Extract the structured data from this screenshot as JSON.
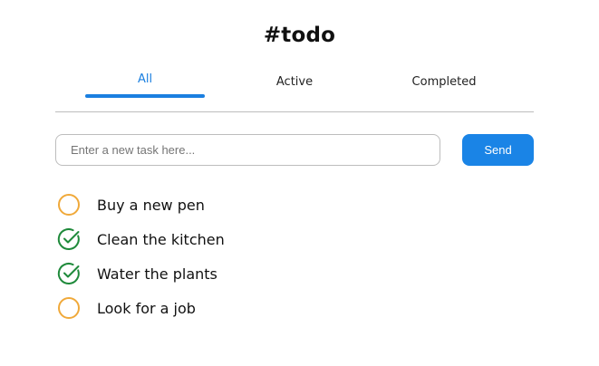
{
  "app": {
    "title": "#todo"
  },
  "tabs": [
    {
      "label": "All",
      "selected": true
    },
    {
      "label": "Active",
      "selected": false
    },
    {
      "label": "Completed",
      "selected": false
    }
  ],
  "new_task": {
    "placeholder": "Enter a new task here...",
    "value": "",
    "send_label": "Send"
  },
  "tasks": [
    {
      "text": "Buy a new pen",
      "completed": false
    },
    {
      "text": "Clean the kitchen",
      "completed": true
    },
    {
      "text": "Water the plants",
      "completed": true
    },
    {
      "text": "Look for a job",
      "completed": false
    }
  ],
  "colors": {
    "accent": "#1a7fe0",
    "send_button": "#1a84e6",
    "unchecked_circle": "#f0a93a",
    "checked_mark": "#1f8a3b"
  },
  "icons": {
    "unchecked": "circle-outline-icon",
    "checked": "check-circle-icon"
  }
}
